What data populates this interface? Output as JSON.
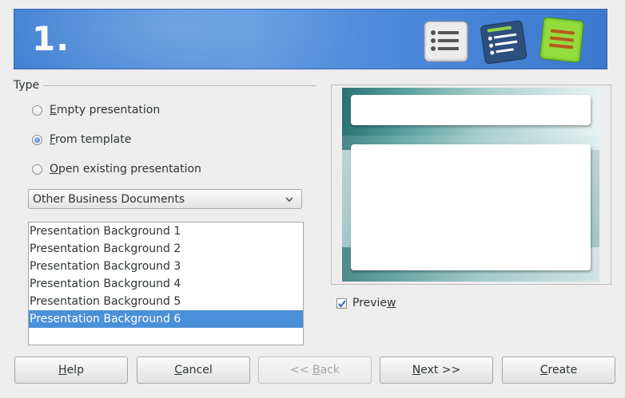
{
  "banner": {
    "step": "1."
  },
  "type_section": {
    "label": "Type",
    "options": [
      {
        "pre": "",
        "mnemonic": "E",
        "post": "mpty presentation",
        "checked": false
      },
      {
        "pre": "",
        "mnemonic": "F",
        "post": "rom template",
        "checked": true
      },
      {
        "pre": "",
        "mnemonic": "O",
        "post": "pen existing presentation",
        "checked": false
      }
    ]
  },
  "category_select": {
    "value": "Other Business Documents"
  },
  "template_list": {
    "items": [
      "Presentation Background 1",
      "Presentation Background 2",
      "Presentation Background 3",
      "Presentation Background 4",
      "Presentation Background 5",
      "Presentation Background 6"
    ],
    "selected_index": 5
  },
  "preview": {
    "label_pre": "Previe",
    "label_mnemonic": "w",
    "label_post": "",
    "checked": true
  },
  "buttons": [
    {
      "name": "help-button",
      "pre": "",
      "mnemonic": "H",
      "post": "elp",
      "enabled": true
    },
    {
      "name": "cancel-button",
      "pre": "",
      "mnemonic": "C",
      "post": "ancel",
      "enabled": true
    },
    {
      "name": "back-button",
      "pre": "<< ",
      "mnemonic": "B",
      "post": "ack",
      "enabled": false
    },
    {
      "name": "next-button",
      "pre": "",
      "mnemonic": "N",
      "post": "ext >>",
      "enabled": true
    },
    {
      "name": "create-button",
      "pre": "",
      "mnemonic": "C",
      "post": "reate",
      "enabled": true
    }
  ],
  "colors": {
    "banner": "#4a86d8",
    "selection": "#4a90d9"
  }
}
